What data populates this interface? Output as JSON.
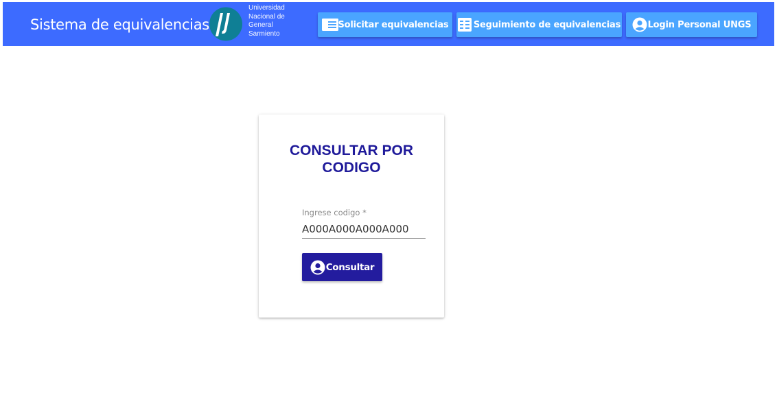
{
  "header": {
    "app_title": "Sistema de equivalencias",
    "logo": {
      "icon": "ungs-logo-icon",
      "text_lines": [
        "Universidad",
        "Nacional de",
        "General",
        "Sarmiento"
      ]
    },
    "nav": [
      {
        "label": "Solicitar equivalencias",
        "icon": "document-icon"
      },
      {
        "label": "Seguimiento de equivalencias",
        "icon": "list-icon"
      },
      {
        "label": "Login Personal UNGS",
        "icon": "account-circle-icon"
      }
    ]
  },
  "card": {
    "title_line1": "CONSULTAR POR",
    "title_line2": "CODIGO",
    "code_field": {
      "label": "Ingrese codigo *",
      "value": "A000A000A000A000"
    },
    "submit": {
      "label": "Consultar",
      "icon": "account-circle-icon"
    }
  },
  "colors": {
    "header_bg": "#3d6bff",
    "nav_button_bg": "#4aa5ff",
    "primary": "#231c9e",
    "title": "#1f1a9a",
    "logo": "#0f7f95"
  }
}
